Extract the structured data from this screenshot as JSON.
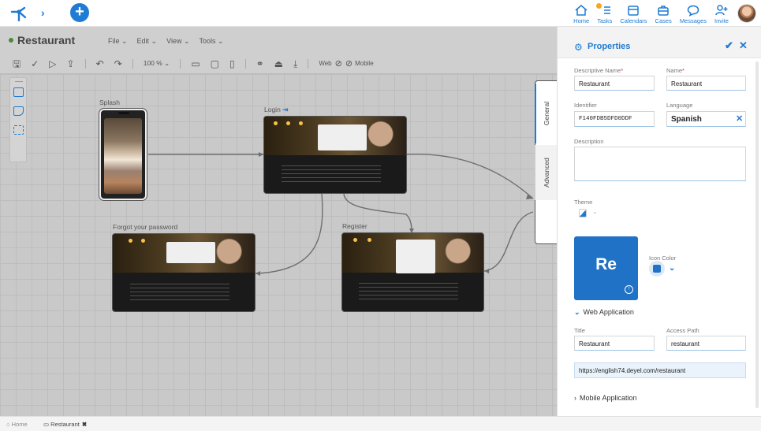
{
  "topbar": {
    "nav": [
      {
        "key": "home",
        "label": "Home"
      },
      {
        "key": "tasks",
        "label": "Tasks"
      },
      {
        "key": "calendars",
        "label": "Calendars"
      },
      {
        "key": "cases",
        "label": "Cases"
      },
      {
        "key": "messages",
        "label": "Messages"
      },
      {
        "key": "invite",
        "label": "Invite"
      }
    ],
    "accent_color": "#1f7bd3",
    "badge_color": "#f5a623"
  },
  "modeler": {
    "app_name": "Restaurant",
    "menu": [
      "File ⌄",
      "Edit ⌄",
      "View ⌄",
      "Tools ⌄"
    ],
    "zoom": "100 % ⌄",
    "web_label": "Web",
    "mobile_label": "Mobile",
    "nodes": {
      "splash": "Splash",
      "login": "Login",
      "forgot": "Forgot your password",
      "register": "Register"
    },
    "side_tabs": {
      "general": "General",
      "advanced": "Advanced"
    }
  },
  "properties": {
    "title": "Properties",
    "descriptive_name_label": "Descriptive Name",
    "descriptive_name_value": "Restaurant",
    "name_label": "Name",
    "name_value": "Restaurant",
    "identifier_label": "Identifier",
    "identifier_value": "F140FDB5DFD0DDF",
    "language_label": "Language",
    "language_value": "Spanish",
    "description_label": "Description",
    "theme_label": "Theme",
    "icon_text": "Re",
    "icon_color_label": "Icon Color",
    "web_section": "Web Application",
    "title_label": "Title",
    "title_value": "Restaurant",
    "access_path_label": "Access Path",
    "access_path_value": "restaurant",
    "url": "https://english74.deyel.com/restaurant",
    "mobile_section": "Mobile Application",
    "icon_tile_color": "#1f72c6"
  },
  "bottom_tabs": [
    {
      "label": "Home"
    },
    {
      "label": "Restaurant"
    }
  ]
}
